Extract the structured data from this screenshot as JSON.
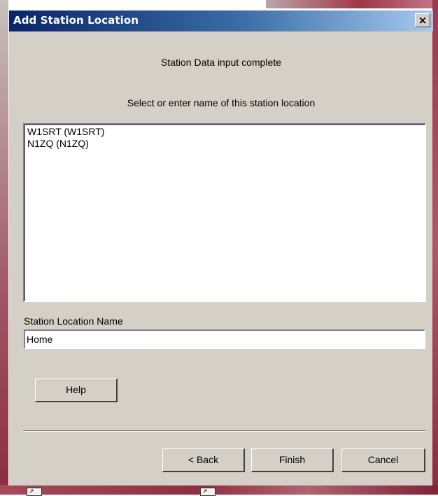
{
  "window": {
    "title": "Add Station Location",
    "close_label": "×"
  },
  "status_text": "Station Data input complete",
  "prompt_text": "Select or enter name of this station location",
  "locations": [
    "W1SRT (W1SRT)",
    "N1ZQ (N1ZQ)"
  ],
  "station_name": {
    "label": "Station Location Name",
    "value": "Home"
  },
  "buttons": {
    "help": "Help",
    "back": "< Back",
    "finish": "Finish",
    "cancel": "Cancel"
  },
  "icons": {
    "close": "close-icon",
    "shortcut": "shortcut-arrow-icon"
  }
}
